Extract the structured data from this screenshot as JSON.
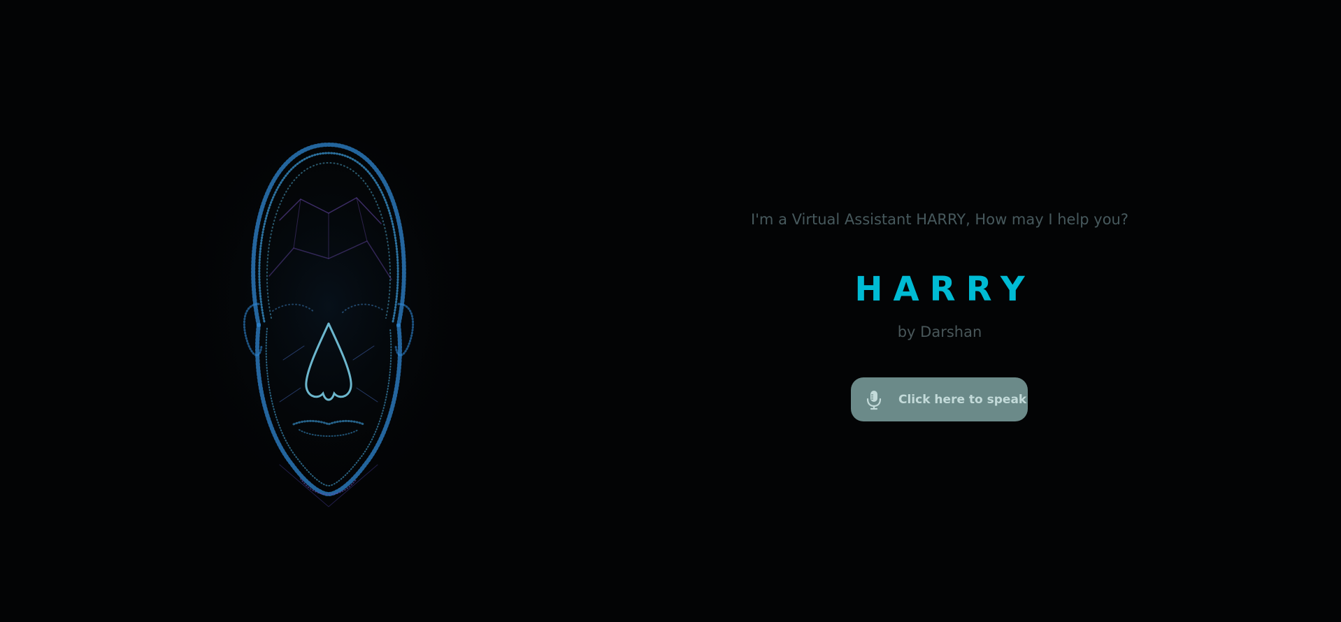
{
  "hero": {
    "image_name": "wireframe-face-illustration"
  },
  "assistant": {
    "greeting": "I'm a Virtual Assistant HARRY, How may I help you?",
    "title": "HARRY",
    "subtitle": "by Darshan"
  },
  "speak_button": {
    "label": "Click here to speak",
    "icon": "microphone-icon"
  },
  "colors": {
    "background": "#030405",
    "accent": "#00bbd4",
    "muted_text": "#47595d",
    "button_bg": "#6b8a89",
    "button_text": "#c3dad9",
    "wireframe": "#2f86d0"
  }
}
